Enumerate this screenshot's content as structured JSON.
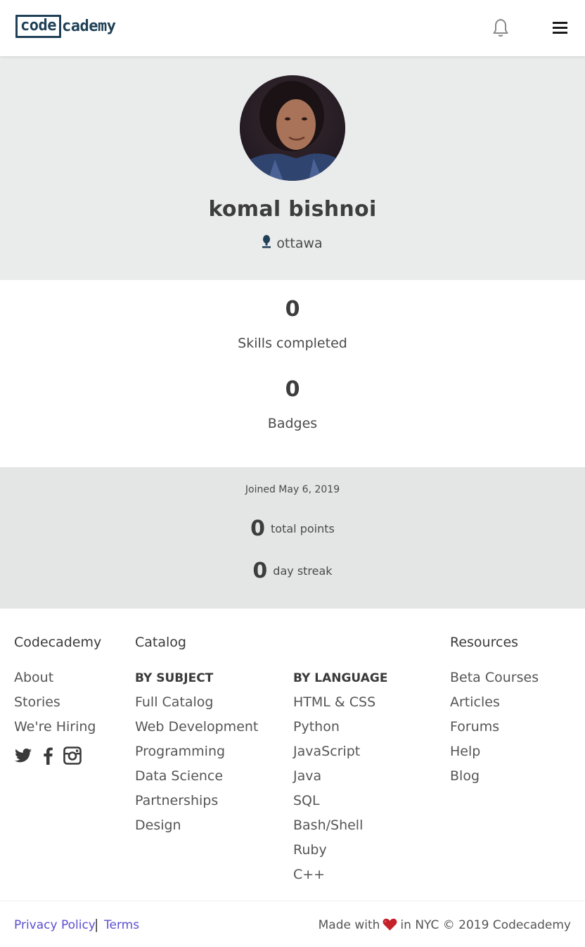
{
  "header": {
    "logo_part1": "code",
    "logo_part2": "cademy",
    "icons": [
      "bell-icon",
      "hamburger-menu-icon"
    ]
  },
  "profile": {
    "name": "komal bishnoi",
    "location": "ottawa"
  },
  "stats": [
    {
      "value": "0",
      "label": "Skills completed"
    },
    {
      "value": "0",
      "label": "Badges"
    }
  ],
  "activity": {
    "joined": "Joined May 6, 2019",
    "points_value": "0",
    "points_label": "total points",
    "streak_value": "0",
    "streak_label": "day streak"
  },
  "footer": {
    "codecademy": {
      "heading": "Codecademy",
      "links": [
        "About",
        "Stories",
        "We're Hiring"
      ],
      "social": [
        "twitter-icon",
        "facebook-icon",
        "instagram-icon"
      ]
    },
    "catalog": {
      "heading": "Catalog",
      "by_subject_heading": "BY SUBJECT",
      "by_subject": [
        "Full Catalog",
        "Web Development",
        "Programming",
        "Data Science",
        "Partnerships",
        "Design"
      ],
      "by_language_heading": "BY LANGUAGE",
      "by_language": [
        "HTML & CSS",
        "Python",
        "JavaScript",
        "Java",
        "SQL",
        "Bash/Shell",
        "Ruby",
        "C++"
      ]
    },
    "resources": {
      "heading": "Resources",
      "links": [
        "Beta Courses",
        "Articles",
        "Forums",
        "Help",
        "Blog"
      ]
    }
  },
  "bottom": {
    "privacy": "Privacy Policy",
    "separator": "|",
    "terms": "Terms",
    "made_prefix": "Made with",
    "made_suffix": "in NYC © 2019 Codecademy"
  },
  "colors": {
    "brand": "#1f4056",
    "link": "#5a4fcf",
    "profile_bg": "#eaebeb",
    "activity_bg": "#e4e5e5",
    "heart": "#c4212a"
  }
}
